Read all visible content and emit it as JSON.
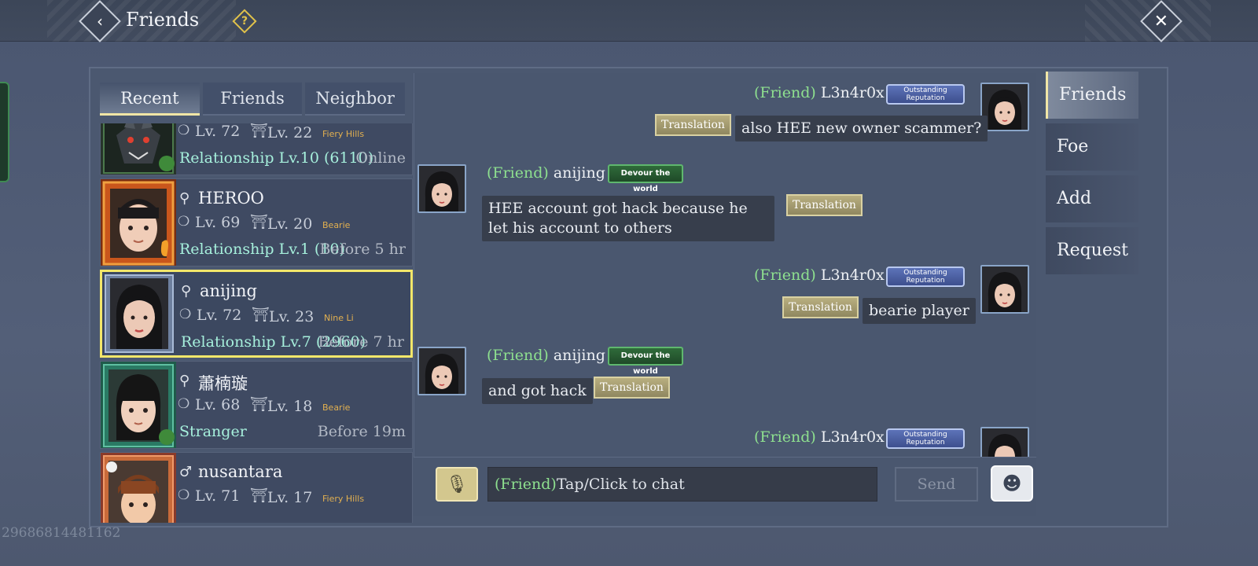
{
  "header": {
    "title": "Friends",
    "back_icon": "chevron-left-icon",
    "help_icon": "question-icon",
    "close_icon": "close-icon"
  },
  "tabs": [
    {
      "label": "Recent",
      "active": true
    },
    {
      "label": "Friends",
      "active": false
    },
    {
      "label": "Neighbor",
      "active": false
    }
  ],
  "friends": [
    {
      "gender": "",
      "name": "",
      "lv1": "Lv. 72",
      "lv2": "Lv. 22",
      "server": "Fiery Hills",
      "relationship": "Relationship Lv.10 (6110)",
      "status": "Online",
      "frame_color": "#3a5a3a"
    },
    {
      "gender": "⚲",
      "name": "HEROO",
      "lv1": "Lv. 69",
      "lv2": "Lv. 20",
      "server": "Bearie",
      "relationship": "Relationship Lv.1 (10)",
      "status": "Before 5 hr",
      "frame_color": "#d9681c"
    },
    {
      "gender": "⚲",
      "name": "anijing",
      "lv1": "Lv. 72",
      "lv2": "Lv. 23",
      "server": "Nine Li",
      "relationship": "Relationship Lv.7 (2960)",
      "status": "Before 7 hr",
      "frame_color": "#7f93b3"
    },
    {
      "gender": "⚲",
      "name": "蕭楠璇",
      "lv1": "Lv. 68",
      "lv2": "Lv. 18",
      "server": "Bearie",
      "relationship": "Stranger",
      "status": "Before 19m",
      "frame_color": "#2e8a74"
    },
    {
      "gender": "♂",
      "name": "nusantara",
      "lv1": "Lv. 71",
      "lv2": "Lv. 17",
      "server": "Fiery Hills",
      "relationship": "",
      "status": "",
      "frame_color": "#c86a3a"
    }
  ],
  "messages": [
    {
      "side": "right",
      "tag": "(Friend)",
      "who": "L3n4r0x",
      "badge": "Outstanding Reputation",
      "text": "also HEE new owner scammer?",
      "translate": "Translation"
    },
    {
      "side": "left",
      "tag": "(Friend)",
      "who": "anijing",
      "badge": "Devour the world",
      "text": "HEE account got hack because he let his account to others",
      "translate": "Translation"
    },
    {
      "side": "right",
      "tag": "(Friend)",
      "who": "L3n4r0x",
      "badge": "Outstanding Reputation",
      "text": "bearie player",
      "translate": "Translation"
    },
    {
      "side": "left",
      "tag": "(Friend)",
      "who": "anijing",
      "badge": "Devour the world",
      "text": "and got hack",
      "translate": "Translation"
    },
    {
      "side": "right",
      "tag": "(Friend)",
      "who": "L3n4r0x",
      "badge": "Outstanding Reputation",
      "text": "",
      "translate": ""
    }
  ],
  "input": {
    "tag": "(Friend)",
    "placeholder": "Tap/Click to chat",
    "send_label": "Send",
    "voice_icon": "microphone-icon",
    "emoji_icon": "emoji-icon"
  },
  "side_menu": [
    {
      "label": "Friends",
      "active": true
    },
    {
      "label": "Foe",
      "active": false
    },
    {
      "label": "Add",
      "active": false
    },
    {
      "label": "Request",
      "active": false
    }
  ],
  "uid": "29686814481162",
  "colors": {
    "accent_gold": "#f3e76a",
    "friend_tag": "#8ee08f",
    "relationship_text": "#a6f0dc"
  }
}
